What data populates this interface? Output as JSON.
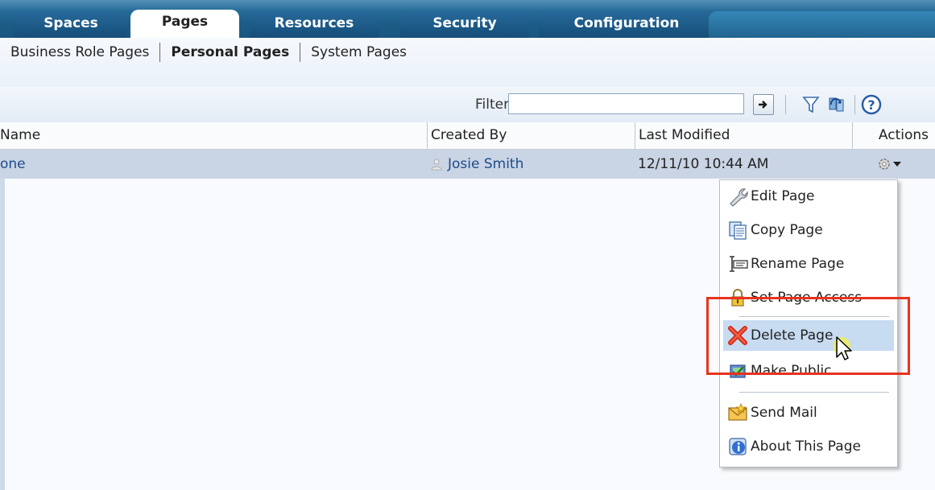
{
  "tabs": [
    {
      "label": "Spaces"
    },
    {
      "label": "Pages"
    },
    {
      "label": "Resources"
    },
    {
      "label": "Security"
    },
    {
      "label": "Configuration"
    }
  ],
  "subnav": {
    "business_role": "Business Role Pages",
    "personal": "Personal Pages",
    "system": "System Pages"
  },
  "toolbar": {
    "filter_label": "Filter",
    "filter_value": "",
    "icons": [
      "go-arrow-icon",
      "filter-funnel-icon",
      "refresh-icon",
      "help-icon"
    ]
  },
  "table": {
    "headers": {
      "name": "Name",
      "created_by": "Created By",
      "last_modified": "Last Modified",
      "actions": "Actions"
    },
    "rows": [
      {
        "name": "one",
        "created_by": "Josie Smith",
        "last_modified": "12/11/10 10:44 AM"
      }
    ]
  },
  "menu": {
    "items": [
      {
        "label": "Edit Page",
        "icon": "wrench-icon"
      },
      {
        "label": "Copy Page",
        "icon": "copy-icon"
      },
      {
        "label": "Rename Page",
        "icon": "rename-icon"
      },
      {
        "label": "Set Page Access",
        "icon": "lock-icon"
      },
      {
        "label": "Delete Page",
        "icon": "delete-x-icon"
      },
      {
        "label": "Make Public",
        "icon": "make-public-icon"
      },
      {
        "label": "Send Mail",
        "icon": "mail-icon"
      },
      {
        "label": "About This Page",
        "icon": "info-icon"
      }
    ]
  },
  "colors": {
    "tabbar": "#1d5d88",
    "selected_row": "#c9d4e4",
    "menu_hover": "#c7dbf1",
    "highlight_box": "#e8331e",
    "link": "#1e4c8a"
  }
}
